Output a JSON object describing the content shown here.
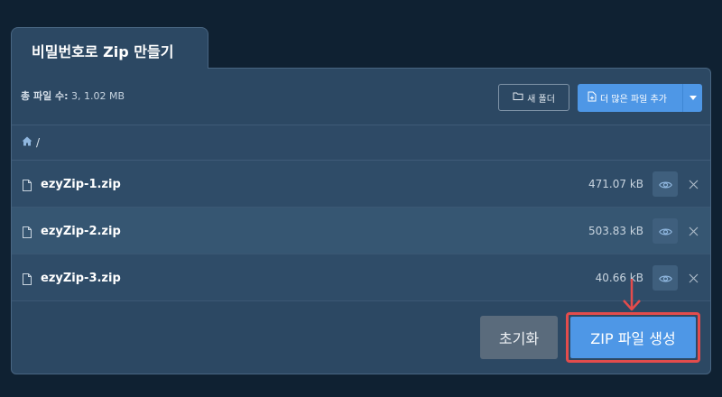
{
  "title": "비밀번호로 Zip 만들기",
  "toolbar": {
    "summary_label": "총 파일 수:",
    "summary_value": "3, 1.02 MB",
    "new_folder_label": "새 폴더",
    "add_files_label": "더 많은 파일 추가"
  },
  "breadcrumb": {
    "separator": "/"
  },
  "files": [
    {
      "name": "ezyZip-1.zip",
      "size": "471.07 kB"
    },
    {
      "name": "ezyZip-2.zip",
      "size": "503.83 kB"
    },
    {
      "name": "ezyZip-3.zip",
      "size": "40.66 kB"
    }
  ],
  "footer": {
    "reset_label": "초기화",
    "create_zip_label": "ZIP 파일 생성"
  },
  "colors": {
    "accent": "#4e97e6",
    "highlight_annotation": "#e34c4c",
    "panel": "#2c4863",
    "background": "#0f2132"
  },
  "icons": [
    "folder-plus-icon",
    "file-plus-icon",
    "chevron-down-icon",
    "home-icon",
    "file-icon",
    "eye-icon",
    "close-icon",
    "arrow-down-annotation"
  ]
}
